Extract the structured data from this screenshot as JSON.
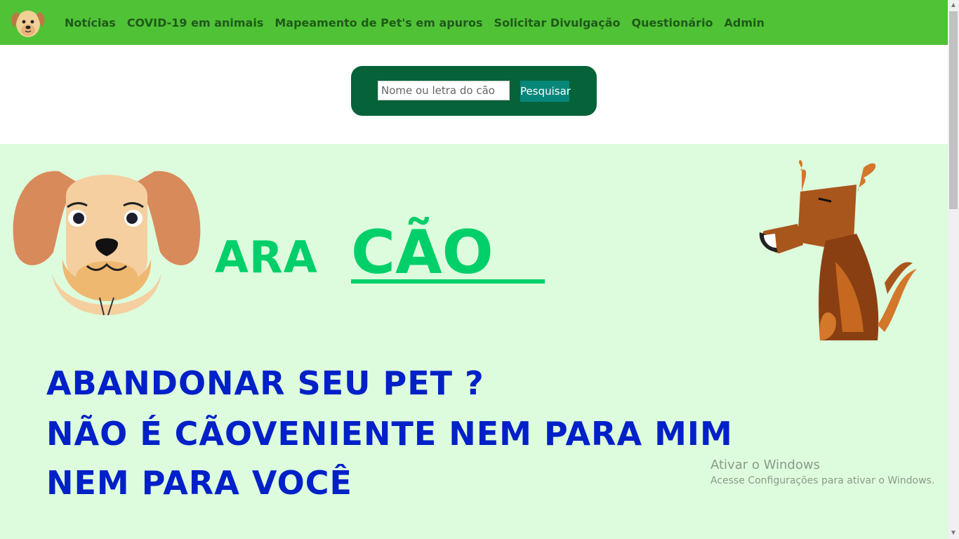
{
  "navbar": {
    "logo_icon": "dog-face-logo",
    "links": [
      "Notícias",
      "COVID-19 em animais",
      "Mapeamento de Pet's em apuros",
      "Solicitar Divulgação",
      "Questionário",
      "Admin"
    ],
    "background": "#50c236"
  },
  "search": {
    "placeholder": "Nome ou letra do cão",
    "value": "",
    "button_label": "Pesquisar"
  },
  "banner": {
    "brand_prefix": "ARA",
    "brand_highlight": "CÃO",
    "slogan_lines": [
      "ABANDONAR SEU PET ?",
      "NÃO É CÃOVENIENTE NEM PARA MIM",
      "NEM PARA VOCÊ"
    ],
    "left_image_icon": "puppy-face-illustration",
    "right_image_icon": "sitting-dog-illustration",
    "brand_color": "#00cf6a",
    "slogan_color": "#0020c8",
    "background": "#ddfcdd"
  },
  "windows_watermark": {
    "title": "Ativar o Windows",
    "subtitle": "Acesse Configurações para ativar o Windows."
  }
}
